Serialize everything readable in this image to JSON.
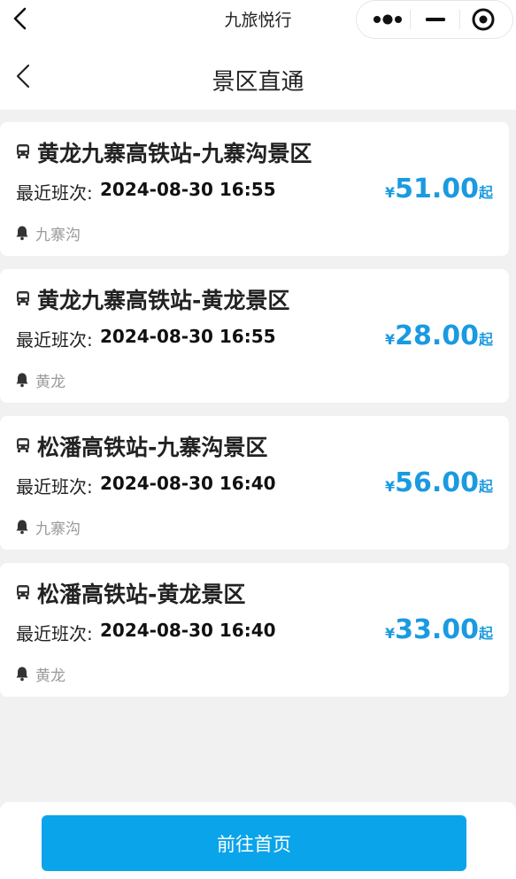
{
  "app": {
    "title": "九旅悦行",
    "icons": [
      "back-chevron-icon",
      "more-dots-icon",
      "minimize-icon",
      "close-target-icon"
    ]
  },
  "header": {
    "title": "景区直通"
  },
  "routes": [
    {
      "name": "黄龙九寨高铁站-九寨沟景区",
      "time_label": "最近班次:",
      "time_value": "2024-08-30 16:55",
      "currency": "¥",
      "price": "51.00",
      "price_suffix": "起",
      "tag": "九寨沟"
    },
    {
      "name": "黄龙九寨高铁站-黄龙景区",
      "time_label": "最近班次:",
      "time_value": "2024-08-30 16:55",
      "currency": "¥",
      "price": "28.00",
      "price_suffix": "起",
      "tag": "黄龙"
    },
    {
      "name": "松潘高铁站-九寨沟景区",
      "time_label": "最近班次:",
      "time_value": "2024-08-30 16:40",
      "currency": "¥",
      "price": "56.00",
      "price_suffix": "起",
      "tag": "九寨沟"
    },
    {
      "name": "松潘高铁站-黄龙景区",
      "time_label": "最近班次:",
      "time_value": "2024-08-30 16:40",
      "currency": "¥",
      "price": "33.00",
      "price_suffix": "起",
      "tag": "黄龙"
    }
  ],
  "footer": {
    "button_label": "前往首页"
  },
  "colors": {
    "accent": "#0aa4ea",
    "price": "#1a9ae0",
    "background": "#f1f1f1",
    "muted": "#9a9a9a"
  }
}
